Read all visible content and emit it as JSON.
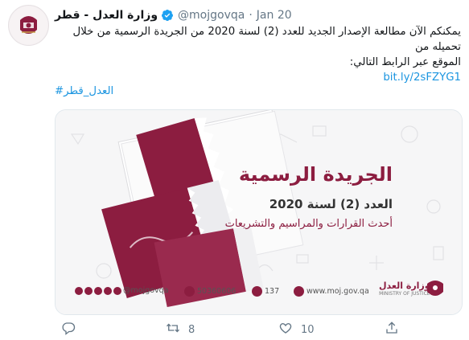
{
  "tweet": {
    "author_name": "وزارة العدل - قطر",
    "handle": "@mojgovqa",
    "separator": "·",
    "date": "Jan 20",
    "text_line1": "يمكنكم الآن مطالعة الإصدار الجديد للعدد (2) لسنة 2020 من الجريدة الرسمية من خلال تحميله من",
    "text_line2": "الموقع عبر الرابط التالي:",
    "link": "bit.ly/2sFZYG1",
    "hashtag": "#العدل_قطر",
    "verified_icon": "verified-badge-icon",
    "link_color": "#1b95e0"
  },
  "media": {
    "gazette_title": "الجريدة الرسمية",
    "issue": "العدد (2) لسنة 2020",
    "subtitle": "أحدث القرارات والمراسيم والتشريعات",
    "footer": {
      "social_handle": "@mojgovqa",
      "whatsapp": "50360606",
      "hotline": "137",
      "website": "www.moj.gov.qa",
      "ministry_ar": "وزارة العدل",
      "ministry_en": "MINISTRY OF JUSTICE"
    },
    "brand_color": "#8c1d40"
  },
  "actions": {
    "reply": {
      "icon": "reply-icon",
      "count": ""
    },
    "retweet": {
      "icon": "retweet-icon",
      "count": "8"
    },
    "like": {
      "icon": "heart-icon",
      "count": "10"
    },
    "share": {
      "icon": "share-icon",
      "count": ""
    }
  }
}
